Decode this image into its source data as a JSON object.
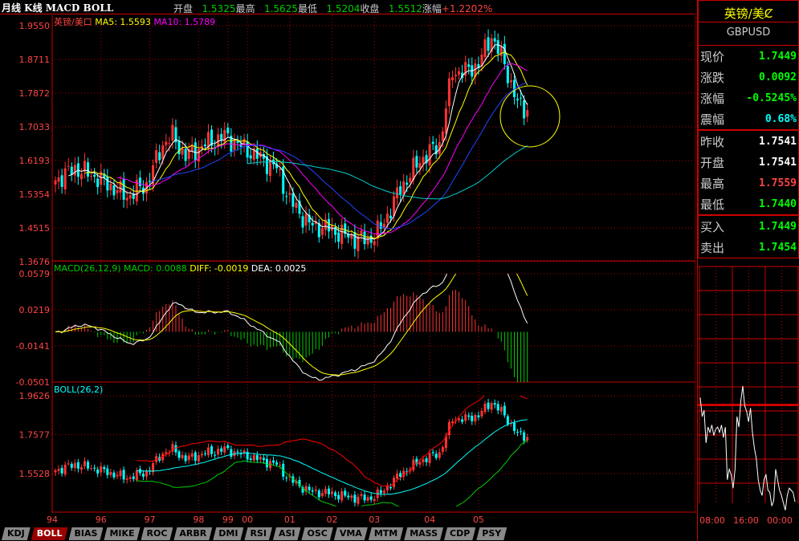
{
  "header": {
    "title": "月线 K线 MACD BOLL",
    "open_label": "开盘",
    "open": "1.5325",
    "high_label": "最高",
    "high": "1.5625",
    "low_label": "最低",
    "low": "1.5204",
    "close_label": "收盘",
    "close": "1.5512",
    "change_label": "涨幅",
    "change": "+1.2202%"
  },
  "legend": {
    "price": {
      "name": "英镑/美口",
      "ma5": "MA5: 1.5593",
      "ma10": "MA10: 1.5789"
    },
    "macd": {
      "name": "MACD(26,12,9)",
      "macd": "MACD: 0.0088",
      "diff": "DIFF: -0.0019",
      "dea": "DEA: 0.0025"
    },
    "boll": {
      "name": "BOLL(26,2)"
    }
  },
  "side": {
    "title": "英镑/美Ȼ",
    "symbol": "GBPUSD",
    "quote": [
      {
        "k": "现价",
        "v": "1.7449",
        "c": "#0f0"
      },
      {
        "k": "涨跌",
        "v": "0.0092",
        "c": "#0f0"
      },
      {
        "k": "涨幅",
        "v": "-0.5245%",
        "c": "#0f0"
      },
      {
        "k": "震幅",
        "v": "0.68%",
        "c": "#0ff"
      }
    ],
    "ohlc": [
      {
        "k": "昨收",
        "v": "1.7541",
        "c": "#fff"
      },
      {
        "k": "开盘",
        "v": "1.7541",
        "c": "#fff"
      },
      {
        "k": "最高",
        "v": "1.7559",
        "c": "#f44"
      },
      {
        "k": "最低",
        "v": "1.7440",
        "c": "#0f0"
      }
    ],
    "bidask": [
      {
        "k": "买入",
        "v": "1.7449",
        "c": "#0f0"
      },
      {
        "k": "卖出",
        "v": "1.7454",
        "c": "#0f0"
      }
    ],
    "intraday_times": [
      "08:00",
      "16:00",
      "00:00"
    ],
    "intraday": [
      1.7548,
      1.753,
      1.7536,
      1.7505,
      1.752,
      1.7515,
      1.7522,
      1.7512,
      1.7518,
      1.752,
      1.7515,
      1.7522,
      1.751,
      1.752,
      1.747,
      1.748,
      1.7475,
      1.7462,
      1.748,
      1.753,
      1.752,
      1.7545,
      1.7559,
      1.754,
      1.7535,
      1.7525,
      1.7538,
      1.7515,
      1.75,
      1.749,
      1.747,
      1.746,
      1.7455,
      1.747,
      1.7475,
      1.746,
      1.7458,
      1.7445,
      1.745,
      1.748,
      1.747,
      1.746,
      1.7455,
      1.7448,
      1.7441,
      1.7455,
      1.7462,
      1.746,
      1.7458,
      1.7449
    ]
  },
  "tabs": [
    "KDJ",
    "BOLL",
    "BIAS",
    "MIKE",
    "ROC",
    "ARBR",
    "DMI",
    "RSI",
    "ASI",
    "OSC",
    "VMA",
    "MTM",
    "MASS",
    "CDP",
    "PSY"
  ],
  "active_tab": "BOLL",
  "chart_data": {
    "type": "candlestick",
    "title": "英镑/美口 月线",
    "x_ticks": [
      [
        "94",
        0
      ],
      [
        "96",
        15
      ],
      [
        "97",
        30
      ],
      [
        "98",
        45
      ],
      [
        "99",
        54
      ],
      [
        "00",
        60
      ],
      [
        "01",
        73
      ],
      [
        "02",
        86
      ],
      [
        "03",
        99
      ],
      [
        "04",
        116
      ],
      [
        "05",
        131
      ]
    ],
    "price_ticks": [
      "1.9550",
      "1.8711",
      "1.7872",
      "1.7033",
      "1.6193",
      "1.5354",
      "1.4515",
      "1.3676"
    ],
    "price_range": [
      1.3676,
      1.955
    ],
    "macd_ticks": [
      "0.0579",
      "0.0219",
      "-0.0141",
      "-0.0501"
    ],
    "macd_range": [
      -0.0501,
      0.0579
    ],
    "boll_ticks": [
      "1.9626",
      "1.7577",
      "1.5528"
    ],
    "close_keypoints": [
      [
        0,
        1.57
      ],
      [
        6,
        1.6
      ],
      [
        12,
        1.58
      ],
      [
        18,
        1.55
      ],
      [
        22,
        1.53
      ],
      [
        28,
        1.56
      ],
      [
        33,
        1.66
      ],
      [
        36,
        1.68
      ],
      [
        40,
        1.63
      ],
      [
        46,
        1.66
      ],
      [
        52,
        1.68
      ],
      [
        56,
        1.66
      ],
      [
        60,
        1.64
      ],
      [
        64,
        1.62
      ],
      [
        68,
        1.6
      ],
      [
        72,
        1.52
      ],
      [
        78,
        1.46
      ],
      [
        84,
        1.45
      ],
      [
        90,
        1.43
      ],
      [
        96,
        1.42
      ],
      [
        100,
        1.45
      ],
      [
        106,
        1.55
      ],
      [
        112,
        1.62
      ],
      [
        118,
        1.66
      ],
      [
        122,
        1.84
      ],
      [
        126,
        1.84
      ],
      [
        130,
        1.86
      ],
      [
        134,
        1.93
      ],
      [
        138,
        1.86
      ],
      [
        142,
        1.76
      ],
      [
        145,
        1.745
      ]
    ]
  }
}
